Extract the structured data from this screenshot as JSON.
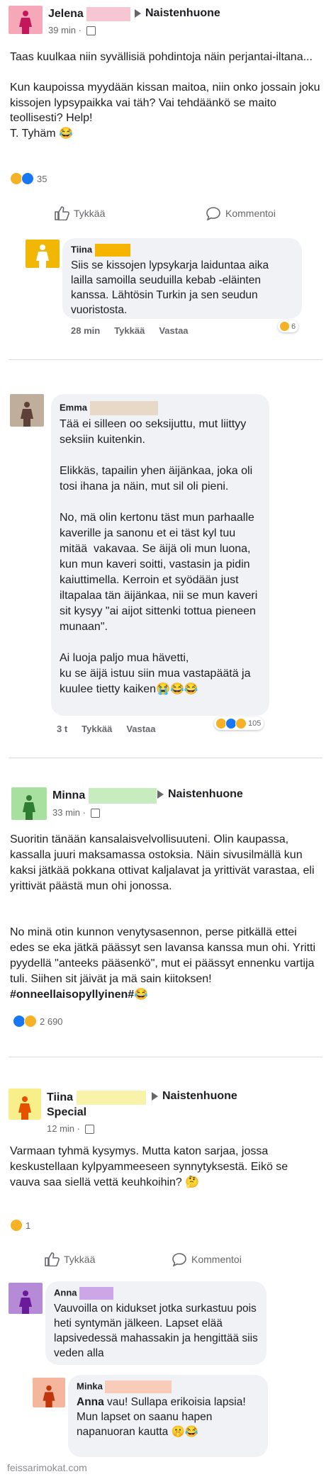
{
  "posts": [
    {
      "author": "Jelena",
      "group": "Naistenhuone",
      "time": "39 min",
      "text": "Taas kuulkaa niin syvällisiä pohdintoja näin perjantai-iltana...\n\nKun kaupoissa myydään kissan maitoa, niin onko jossain joku kissojen lypsypaikka vai täh? Vai tehdäänkö se maito teollisesti? Help!\nT. Tyhäm 😂",
      "reactions": "35",
      "like_label": "Tykkää",
      "comment_label": "Kommentoi",
      "comments": [
        {
          "author": "Tiina",
          "text": "Siis se kissojen lypsykarja laiduntaa aika lailla samoilla seuduilla kebab -eläinten kanssa. Lähtösin Turkin ja sen seudun vuoristosta.",
          "time": "28 min",
          "like": "Tykkää",
          "reply": "Vastaa",
          "reactions": "6"
        }
      ]
    },
    {
      "comment_author": "Emma",
      "text": "Tää ei silleen oo seksijuttu, mut liittyy seksiin kuitenkin.\n\nElikkäs, tapailin yhen äijänkaa, joka oli tosi ihana ja näin, mut sil oli pieni.\n\nNo, mä olin kertonu täst mun parhaalle kaverille ja sanonu et ei täst kyl tuu mitää  vakavaa. Se äijä oli mun luona, kun mun kaveri soitti, vastasin ja pidin kaiuttimella. Kerroin et syödään just iltapalaa tän äijänkaa, nii se mun kaveri sit kysyy \"ai aijot sittenki tottua pieneen munaan\".\n\nAi luoja paljo mua hävetti,\nku se äijä istuu siin mua vastapäätä ja kuulee tietty kaiken😭😂😂",
      "time": "3 t",
      "like": "Tykkää",
      "reply": "Vastaa",
      "reactions": "105"
    },
    {
      "author": "Minna",
      "group": "Naistenhuone",
      "time": "33 min",
      "para1": "Suoritin tänään kansalaisvelvollisuuteni. Olin kaupassa, kassalla juuri maksamassa ostoksia. Näin sivusilmällä kun kaksi jätkää pokkana ottivat kaljalavat ja yrittivät varastaa, eli yrittivät päästä mun ohi jonossa.",
      "para2": "No minä otin kunnon venytysasennon, perse pitkällä ettei edes se eka jätkä päässyt sen lavansa kanssa mun ohi. Yritti pyydellä \"anteeks pääsenkö\", mut ei päässyt ennenku vartija tuli. Siihen sit jäivät ja mä sain kiitoksen! ",
      "hashtag": "#onneellaisopyllyinen#",
      "emoji_end": "😂",
      "reactions": "2 690"
    },
    {
      "author": "Tiina",
      "author_line2": "Special",
      "group": "Naistenhuone",
      "time": "12 min",
      "text": "Varmaan tyhmä kysymys. Mutta katon sarjaa, jossa keskustellaan kylpyammeeseen synnytyksestä. Eikö se vauva saa siellä vettä keuhkoihin? 🤔",
      "reactions": "1",
      "like_label": "Tykkää",
      "comment_label": "Kommentoi",
      "comments": [
        {
          "author": "Anna",
          "text": "Vauvoilla on kidukset jotka surkastuu pois heti syntymän jälkeen. Lapset elää lapsivedessä mahassakin ja hengittää siis veden alla"
        },
        {
          "author": "Minka",
          "mention": "Anna",
          "text": " vau! Sullapa erikoisia lapsia! Mun lapset on saanu hapen napanuoran kautta 🤫😂"
        }
      ]
    }
  ],
  "watermark": "feissarimokat.com",
  "colors": {
    "avatar_pink": "#f7a8b8",
    "avatar_yellow": "#f2b705",
    "avatar_brown": "#bfae9c",
    "avatar_green": "#a8e0a0",
    "avatar_lightyellow": "#f9ef8a",
    "avatar_purple": "#b58ad6",
    "avatar_peach": "#f4b79e",
    "redact_pink": "#f7c6d3",
    "redact_yellow": "#f5b400",
    "redact_beige": "#e8d8c8",
    "redact_green": "#c6ecc0",
    "redact_lightyellow": "#f7f3a8",
    "redact_purple": "#cda6e8",
    "redact_peach": "#f7ccb8"
  }
}
